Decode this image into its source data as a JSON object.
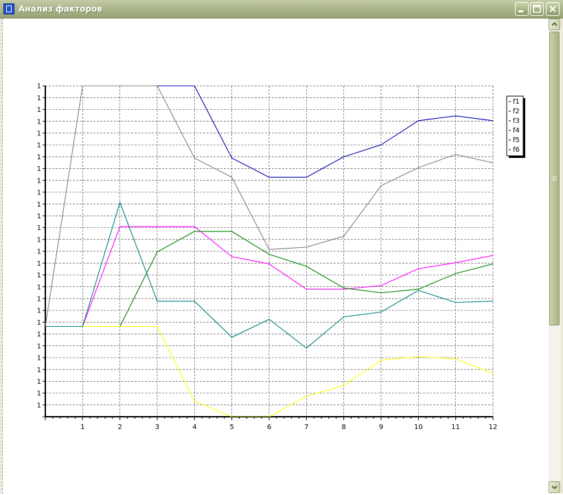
{
  "window": {
    "title": "Анализ факторов"
  },
  "colors": {
    "titlebar": "#a0ab7d",
    "f1": "#0000b0",
    "f2": "#808080",
    "f3": "#ff00ff",
    "f4": "#008000",
    "f5": "#008080",
    "f6": "#ffff00"
  },
  "icons": [
    "app-icon",
    "minimize-icon",
    "maximize-icon",
    "close-icon",
    "scroll-up-icon",
    "scroll-down-icon"
  ],
  "chart_data": {
    "type": "line",
    "x": [
      0,
      1,
      2,
      3,
      4,
      5,
      6,
      7,
      8,
      9,
      10,
      11,
      12
    ],
    "x_tick_labels": [
      "1",
      "2",
      "3",
      "4",
      "5",
      "6",
      "7",
      "8",
      "9",
      "10",
      "11",
      "12"
    ],
    "y_tick_labels": [
      "1",
      "1",
      "1",
      "1",
      "1",
      "1",
      "1",
      "1",
      "1",
      "1",
      "1",
      "1",
      "1",
      "1",
      "1",
      "1",
      "1",
      "1",
      "1",
      "1",
      "1",
      "1",
      "1",
      "1",
      "1",
      "1",
      "1",
      "1"
    ],
    "ylim": [
      0,
      27.5
    ],
    "grid": true,
    "legend_position": "right",
    "series": [
      {
        "name": "f1",
        "color": "#0000b0",
        "values": [
          null,
          null,
          null,
          27.5,
          27.5,
          21.5,
          19.9,
          19.9,
          21.6,
          22.6,
          24.6,
          25.0,
          24.6
        ]
      },
      {
        "name": "f2",
        "color": "#808080",
        "values": [
          7.5,
          27.5,
          27.5,
          27.5,
          21.5,
          19.9,
          13.9,
          14.1,
          15.0,
          19.2,
          20.7,
          21.8,
          21.1
        ]
      },
      {
        "name": "f3",
        "color": "#ff00ff",
        "values": [
          7.5,
          7.5,
          15.8,
          15.8,
          15.8,
          13.3,
          12.7,
          10.6,
          10.6,
          10.9,
          12.3,
          12.8,
          13.4
        ]
      },
      {
        "name": "f4",
        "color": "#008000",
        "values": [
          null,
          null,
          7.5,
          13.7,
          15.4,
          15.4,
          13.5,
          12.5,
          10.7,
          10.3,
          10.6,
          11.9,
          12.7
        ]
      },
      {
        "name": "f5",
        "color": "#008080",
        "values": [
          7.5,
          7.5,
          17.8,
          9.6,
          9.6,
          6.6,
          8.1,
          5.7,
          8.3,
          8.7,
          10.5,
          9.5,
          9.6
        ]
      },
      {
        "name": "f6",
        "color": "#ffff00",
        "values": [
          null,
          7.5,
          7.5,
          7.5,
          1.3,
          0,
          0,
          1.7,
          2.6,
          4.7,
          5.0,
          4.8,
          3.6
        ]
      }
    ]
  }
}
